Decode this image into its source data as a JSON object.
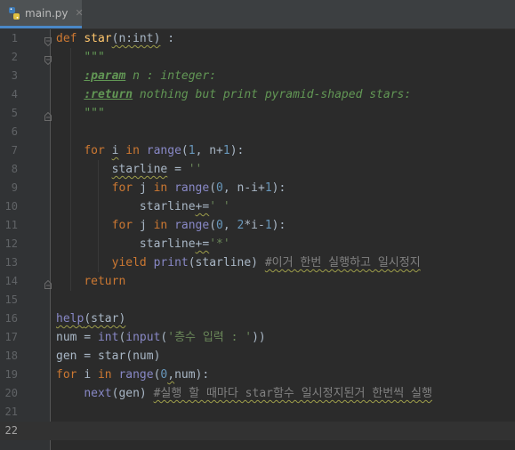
{
  "tab": {
    "filename": "main.py",
    "close_glyph": "✕"
  },
  "colors": {
    "background": "#2b2b2b",
    "gutter": "#313335",
    "keyword": "#cc7832",
    "function": "#ffc66d",
    "number": "#6897bb",
    "string": "#6a8759",
    "docstring": "#629755",
    "comment": "#808080"
  },
  "current_line": 22,
  "lines": [
    {
      "n": "1",
      "tokens": [
        {
          "t": "def ",
          "c": "kw"
        },
        {
          "t": "star",
          "c": "fn"
        },
        {
          "t": "(n:int)",
          "c": "",
          "sq": true
        },
        {
          "t": " :",
          "c": ""
        }
      ]
    },
    {
      "n": "2",
      "tokens": [
        {
          "t": "    ",
          "c": ""
        },
        {
          "t": "\"\"\"",
          "c": "doc"
        }
      ]
    },
    {
      "n": "3",
      "tokens": [
        {
          "t": "    ",
          "c": ""
        },
        {
          "t": ":param",
          "c": "doctag"
        },
        {
          "t": " n : integer:",
          "c": "doc"
        }
      ]
    },
    {
      "n": "4",
      "tokens": [
        {
          "t": "    ",
          "c": ""
        },
        {
          "t": ":return",
          "c": "doctag"
        },
        {
          "t": " nothing but print pyramid-shaped stars:",
          "c": "doc"
        }
      ]
    },
    {
      "n": "5",
      "tokens": [
        {
          "t": "    ",
          "c": ""
        },
        {
          "t": "\"\"\"",
          "c": "doc"
        }
      ]
    },
    {
      "n": "6",
      "tokens": []
    },
    {
      "n": "7",
      "tokens": [
        {
          "t": "    ",
          "c": ""
        },
        {
          "t": "for ",
          "c": "kw"
        },
        {
          "t": "i",
          "c": "",
          "sq": true
        },
        {
          "t": " in ",
          "c": "kw"
        },
        {
          "t": "range",
          "c": "bi"
        },
        {
          "t": "(",
          "c": ""
        },
        {
          "t": "1",
          "c": "num"
        },
        {
          "t": ", n+",
          "c": ""
        },
        {
          "t": "1",
          "c": "num"
        },
        {
          "t": "):",
          "c": ""
        }
      ]
    },
    {
      "n": "8",
      "tokens": [
        {
          "t": "        ",
          "c": ""
        },
        {
          "t": "starline",
          "c": "",
          "sq": true
        },
        {
          "t": " = ",
          "c": ""
        },
        {
          "t": "''",
          "c": "str"
        }
      ]
    },
    {
      "n": "9",
      "tokens": [
        {
          "t": "        ",
          "c": ""
        },
        {
          "t": "for ",
          "c": "kw"
        },
        {
          "t": "j",
          "c": ""
        },
        {
          "t": " in ",
          "c": "kw"
        },
        {
          "t": "range",
          "c": "bi"
        },
        {
          "t": "(",
          "c": ""
        },
        {
          "t": "0",
          "c": "num"
        },
        {
          "t": ", n-i+",
          "c": ""
        },
        {
          "t": "1",
          "c": "num"
        },
        {
          "t": "):",
          "c": ""
        }
      ]
    },
    {
      "n": "10",
      "tokens": [
        {
          "t": "            ",
          "c": ""
        },
        {
          "t": "starline",
          "c": ""
        },
        {
          "t": "+=",
          "c": "",
          "sq": true
        },
        {
          "t": "' '",
          "c": "str"
        }
      ]
    },
    {
      "n": "11",
      "tokens": [
        {
          "t": "        ",
          "c": ""
        },
        {
          "t": "for ",
          "c": "kw"
        },
        {
          "t": "j",
          "c": ""
        },
        {
          "t": " in ",
          "c": "kw"
        },
        {
          "t": "range",
          "c": "bi"
        },
        {
          "t": "(",
          "c": ""
        },
        {
          "t": "0",
          "c": "num"
        },
        {
          "t": ", ",
          "c": ""
        },
        {
          "t": "2",
          "c": "num"
        },
        {
          "t": "*i-",
          "c": ""
        },
        {
          "t": "1",
          "c": "num"
        },
        {
          "t": "):",
          "c": ""
        }
      ]
    },
    {
      "n": "12",
      "tokens": [
        {
          "t": "            ",
          "c": ""
        },
        {
          "t": "starline",
          "c": ""
        },
        {
          "t": "+=",
          "c": "",
          "sq": true
        },
        {
          "t": "'*'",
          "c": "str"
        }
      ]
    },
    {
      "n": "13",
      "tokens": [
        {
          "t": "        ",
          "c": ""
        },
        {
          "t": "yield ",
          "c": "kw"
        },
        {
          "t": "print",
          "c": "bi"
        },
        {
          "t": "(starline) ",
          "c": ""
        },
        {
          "t": "#이거 한번 실행하고 일시정지",
          "c": "cm",
          "sq": true
        }
      ]
    },
    {
      "n": "14",
      "tokens": [
        {
          "t": "    ",
          "c": ""
        },
        {
          "t": "return",
          "c": "kw"
        }
      ]
    },
    {
      "n": "15",
      "tokens": []
    },
    {
      "n": "16",
      "tokens": [
        {
          "t": "help",
          "c": "bi",
          "sq": true
        },
        {
          "t": "(star)",
          "c": "",
          "sq": true
        }
      ]
    },
    {
      "n": "17",
      "tokens": [
        {
          "t": "num = ",
          "c": ""
        },
        {
          "t": "int",
          "c": "bi"
        },
        {
          "t": "(",
          "c": ""
        },
        {
          "t": "input",
          "c": "bi"
        },
        {
          "t": "(",
          "c": ""
        },
        {
          "t": "'층수 입력 : '",
          "c": "str"
        },
        {
          "t": "))",
          "c": ""
        }
      ]
    },
    {
      "n": "18",
      "tokens": [
        {
          "t": "gen = star(num)",
          "c": ""
        }
      ]
    },
    {
      "n": "19",
      "tokens": [
        {
          "t": "for ",
          "c": "kw"
        },
        {
          "t": "i",
          "c": ""
        },
        {
          "t": " in ",
          "c": "kw"
        },
        {
          "t": "range",
          "c": "bi"
        },
        {
          "t": "(",
          "c": ""
        },
        {
          "t": "0",
          "c": "num"
        },
        {
          "t": ",",
          "c": "",
          "sq": true
        },
        {
          "t": "num):",
          "c": ""
        }
      ]
    },
    {
      "n": "20",
      "tokens": [
        {
          "t": "    ",
          "c": ""
        },
        {
          "t": "next",
          "c": "bi"
        },
        {
          "t": "(gen) ",
          "c": ""
        },
        {
          "t": "#실행 할 때마다 star함수 일시정지된거 한번씩 실행",
          "c": "cm",
          "sq": true
        }
      ]
    },
    {
      "n": "21",
      "tokens": []
    },
    {
      "n": "22",
      "tokens": []
    }
  ]
}
